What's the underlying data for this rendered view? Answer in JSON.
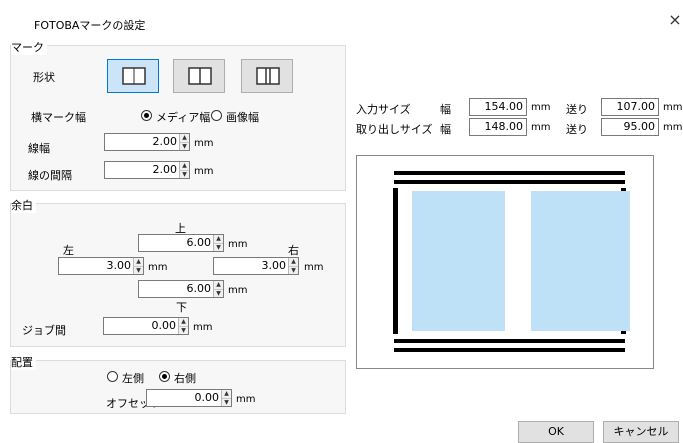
{
  "window": {
    "title": "FOTOBAマークの設定",
    "close_symbol": "×"
  },
  "mark": {
    "group_label": "マーク",
    "shape_label": "形状",
    "shape_options": [
      "shape-single-frame-icon",
      "shape-center-line-icon",
      "shape-double-line-icon"
    ],
    "selected_shape": 0,
    "width_label": "横マーク幅",
    "width_options": [
      "メディア幅",
      "画像幅"
    ],
    "width_selected": "メディア幅",
    "line_width_label": "線幅",
    "line_width_value": "2.00",
    "line_gap_label": "線の間隔",
    "line_gap_value": "2.00",
    "unit": "mm"
  },
  "margin": {
    "group_label": "余白",
    "top_label": "上",
    "top_value": "6.00",
    "left_label": "左",
    "left_value": "3.00",
    "right_label": "右",
    "right_value": "3.00",
    "bottom_label": "下",
    "bottom_value": "6.00",
    "job_gap_label": "ジョブ間",
    "job_gap_value": "0.00",
    "unit": "mm"
  },
  "placement": {
    "group_label": "配置",
    "options": [
      "左側",
      "右側"
    ],
    "selected": "右側",
    "offset_label": "オフセット",
    "offset_value": "0.00",
    "unit": "mm"
  },
  "sizes": {
    "input_label": "入力サイズ",
    "output_label": "取り出しサイズ",
    "width_label": "幅",
    "feed_label": "送り",
    "input_width": "154.00",
    "input_feed": "107.00",
    "output_width": "148.00",
    "output_feed": "95.00",
    "unit": "mm"
  },
  "buttons": {
    "ok": "OK",
    "cancel": "キャンセル"
  },
  "colors": {
    "accent": "#0078d7",
    "selected_fill": "#cce4f7",
    "preview_panel": "#bfe1f7"
  }
}
